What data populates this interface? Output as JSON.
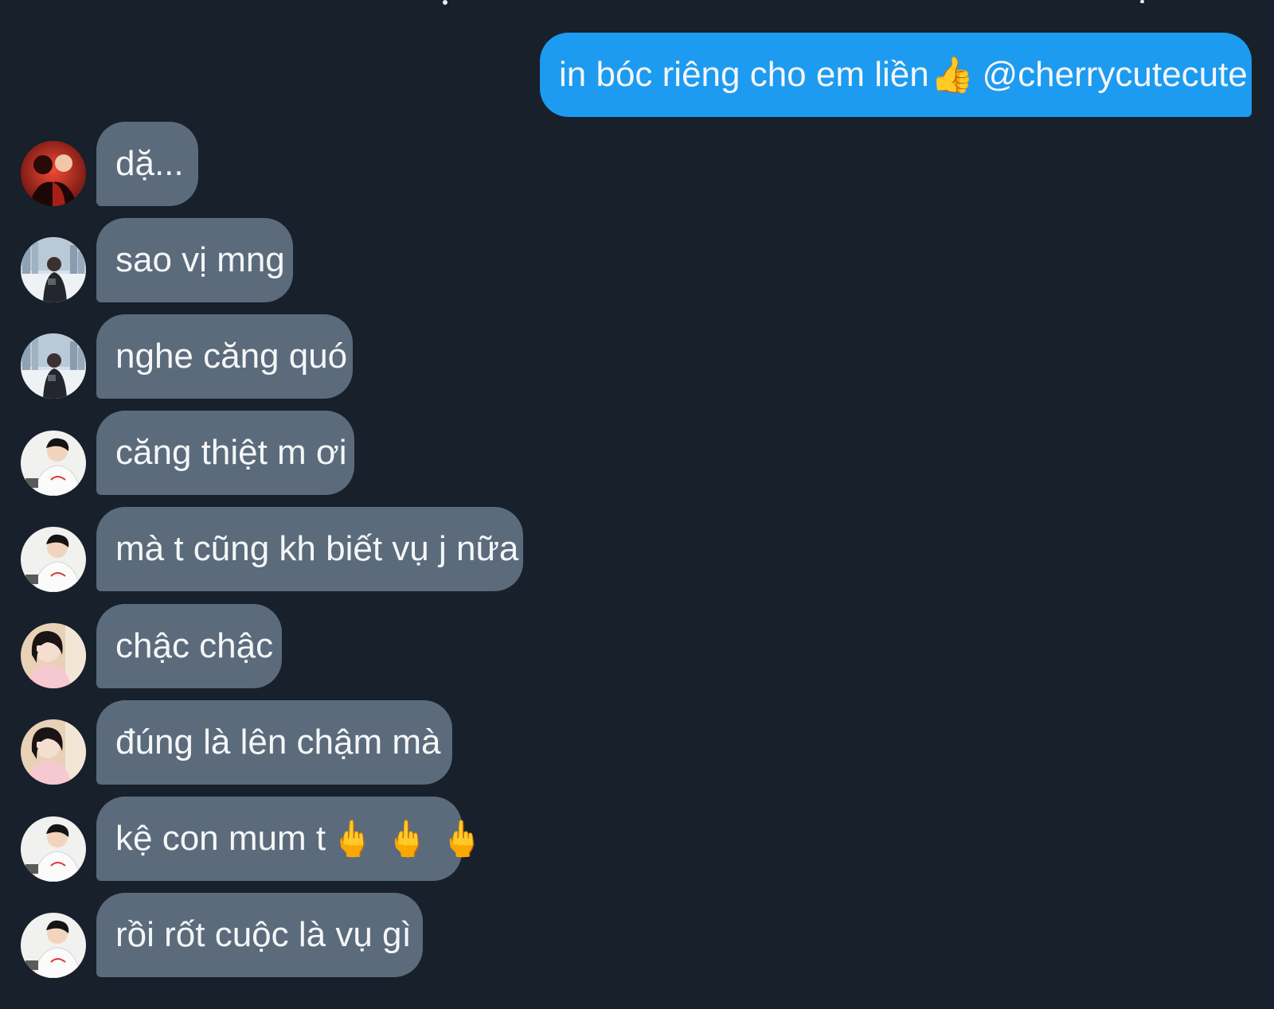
{
  "conversation": {
    "outgoing": {
      "text": "in bóc riêng cho em liền",
      "emoji": "👍",
      "mention": "@cherrycutecute"
    },
    "incoming": [
      {
        "text": "dặ...",
        "emoji": "",
        "avatar": "avatar-red"
      },
      {
        "text": "sao vị mng",
        "emoji": "",
        "avatar": "avatar-city"
      },
      {
        "text": "nghe căng quó",
        "emoji": "",
        "avatar": "avatar-city"
      },
      {
        "text": "căng thiệt m ơi",
        "emoji": "",
        "avatar": "avatar-boy"
      },
      {
        "text": "mà t cũng kh biết vụ j nữa",
        "emoji": "",
        "avatar": "avatar-boy"
      },
      {
        "text": "chậc chậc",
        "emoji": "",
        "avatar": "avatar-girl"
      },
      {
        "text": "đúng là lên chậm mà",
        "emoji": "",
        "avatar": "avatar-girl"
      },
      {
        "text": "kệ con mum t",
        "emoji": "🖕 🖕 🖕",
        "avatar": "avatar-boy"
      },
      {
        "text": "rồi rốt cuộc là vụ gì",
        "emoji": "",
        "avatar": "avatar-boy"
      }
    ]
  },
  "colors": {
    "background": "#18202b",
    "outgoing_bubble": "#1d9bf0",
    "incoming_bubble": "#5b6b7b",
    "text": "#f4f6f8"
  }
}
